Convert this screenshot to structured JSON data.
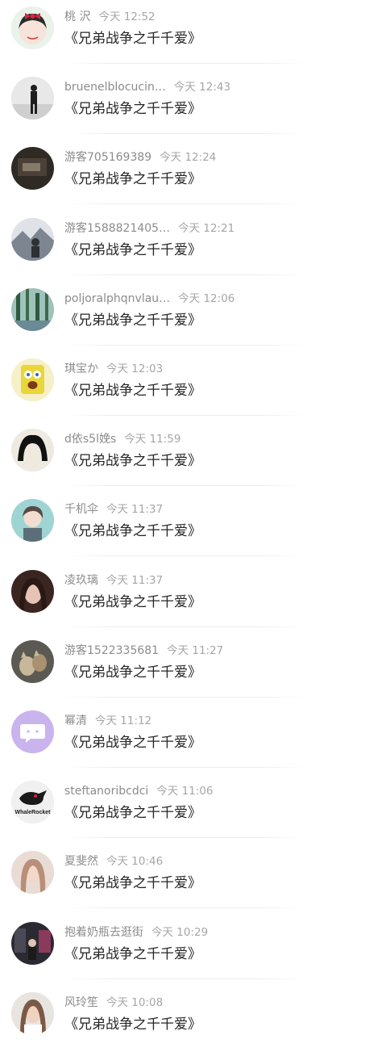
{
  "comments": [
    {
      "user": "桃 沢",
      "time": "今天 12:52",
      "message": "《兄弟战争之千千爱》",
      "avatar": "girl-red-bow-avatar",
      "colors": [
        "#f2d7e2",
        "#2b2b2b"
      ]
    },
    {
      "user": "bruenelblocucin…",
      "time": "今天 12:43",
      "message": "《兄弟战争之千千爱》",
      "avatar": "person-standing-avatar",
      "colors": [
        "#e8e8e8",
        "#1e1e1e"
      ]
    },
    {
      "user": "游客705169389",
      "time": "今天 12:24",
      "message": "《兄弟战争之千千爱》",
      "avatar": "dark-photo-avatar",
      "colors": [
        "#2f2a24",
        "#bfb39e"
      ]
    },
    {
      "user": "游客1588821405…",
      "time": "今天 12:21",
      "message": "《兄弟战争之千千爱》",
      "avatar": "landscape-person-avatar",
      "colors": [
        "#c9ccd1",
        "#2e3036"
      ]
    },
    {
      "user": "poljoralphqnvlau…",
      "time": "今天 12:06",
      "message": "《兄弟战争之千千爱》",
      "avatar": "forest-avatar",
      "colors": [
        "#2e5a3e",
        "#8fb7b0"
      ]
    },
    {
      "user": "琪宝か",
      "time": "今天 12:03",
      "message": "《兄弟战争之千千爱》",
      "avatar": "spongebob-avatar",
      "colors": [
        "#f6f0c8",
        "#e8d63a"
      ]
    },
    {
      "user": "d依s5l娩s",
      "time": "今天 11:59",
      "message": "《兄弟战争之千千爱》",
      "avatar": "black-hair-avatar",
      "colors": [
        "#efeae0",
        "#111111"
      ]
    },
    {
      "user": "千机伞",
      "time": "今天 11:37",
      "message": "《兄弟战争之千千爱》",
      "avatar": "anime-boy-avatar",
      "colors": [
        "#9fd4d4",
        "#5a4a44"
      ]
    },
    {
      "user": "凌玖璃",
      "time": "今天 11:37",
      "message": "《兄弟战争之千千爱》",
      "avatar": "woman-portrait-avatar",
      "colors": [
        "#3a2520",
        "#e6c3b4"
      ]
    },
    {
      "user": "游客1522335681",
      "time": "今天 11:27",
      "message": "《兄弟战争之千千爱》",
      "avatar": "cats-avatar",
      "colors": [
        "#5b5a52",
        "#c8b79a"
      ]
    },
    {
      "user": "幂清",
      "time": "今天 11:12",
      "message": "《兄弟战争之千千爱》",
      "avatar": "chat-bubble-avatar",
      "colors": [
        "#c9b4ee",
        "#ffffff"
      ]
    },
    {
      "user": "steftanoribcdci",
      "time": "今天 11:06",
      "message": "《兄弟战争之千千爱》",
      "avatar": "whale-rocket-logo-avatar",
      "colors": [
        "#f0f0f0",
        "#1a1a1a"
      ]
    },
    {
      "user": "夏斐然",
      "time": "今天 10:46",
      "message": "《兄弟战争之千千爱》",
      "avatar": "girl-portrait-avatar",
      "colors": [
        "#e9dcd4",
        "#b88f78"
      ]
    },
    {
      "user": "抱着奶瓶去逛街",
      "time": "今天 10:29",
      "message": "《兄弟战争之千千爱》",
      "avatar": "street-photo-avatar",
      "colors": [
        "#2a2a32",
        "#8a3a5a"
      ]
    },
    {
      "user": "风玲笙",
      "time": "今天 10:08",
      "message": "《兄弟战争之千千爱》",
      "avatar": "woman-photo-avatar",
      "colors": [
        "#e8e4df",
        "#7a5a46"
      ]
    }
  ],
  "whale_logo_text": "WhaleRocket"
}
